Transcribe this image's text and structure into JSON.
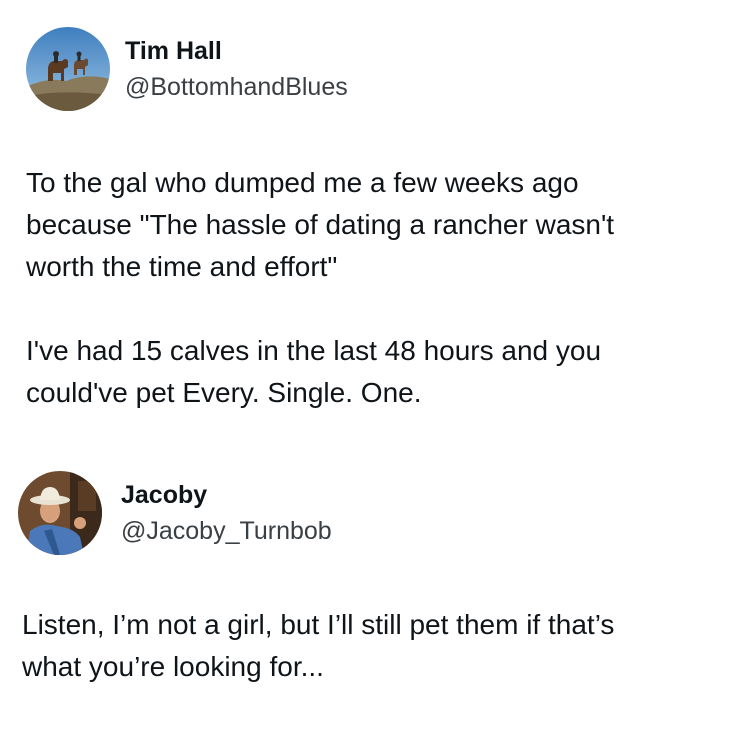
{
  "posts": [
    {
      "display_name": "Tim Hall",
      "handle": "@BottomhandBlues",
      "avatar_icon": "horse-rider-silhouette-avatar",
      "paragraphs": [
        [
          "To the gal who dumped me a few weeks ago",
          "because \"The hassle of dating a rancher wasn't",
          "worth the time and effort\""
        ],
        [
          "I've had 15 calves in the last 48 hours and you",
          "could've pet Every. Single. One."
        ]
      ]
    },
    {
      "display_name": "Jacoby",
      "handle": "@Jacoby_Turnbob",
      "avatar_icon": "cowboy-hat-man-avatar",
      "paragraphs": [
        [
          "Listen, I’m not a girl, but I’ll still pet them if that’s",
          "what you’re looking for..."
        ]
      ]
    }
  ],
  "colors": {
    "text": "#0f1419",
    "handle": "#3a3f44",
    "background": "#ffffff"
  }
}
